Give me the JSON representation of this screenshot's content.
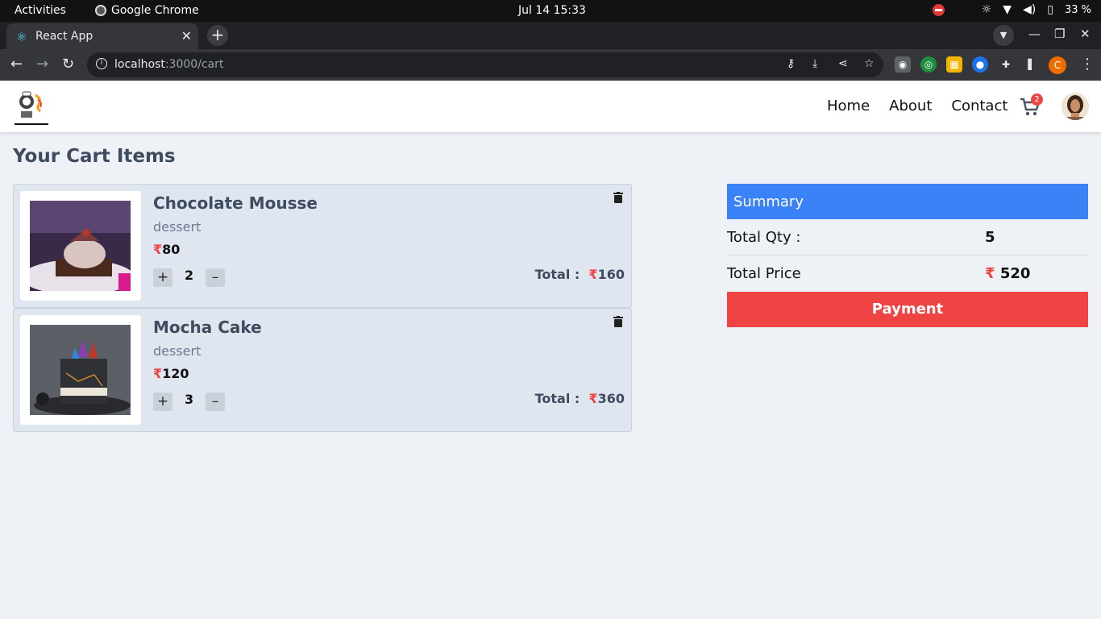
{
  "os_bar": {
    "activities": "Activities",
    "app_name": "Google Chrome",
    "clock": "Jul 14  15:33",
    "battery": "33 %"
  },
  "browser": {
    "tab_title": "React App",
    "url_host": "localhost",
    "url_path": ":3000/cart",
    "profile_initial": "C"
  },
  "navbar": {
    "links": [
      "Home",
      "About",
      "Contact"
    ],
    "cart_count": "2"
  },
  "cart": {
    "title": "Your Cart Items",
    "currency": "₹",
    "total_label": "Total :",
    "items": [
      {
        "name": "Chocolate Mousse",
        "category": "dessert",
        "price": "80",
        "qty": "2",
        "total": "160",
        "image": "chocolate-mousse-image"
      },
      {
        "name": "Mocha Cake",
        "category": "dessert",
        "price": "120",
        "qty": "3",
        "total": "360",
        "image": "mocha-cake-image"
      }
    ]
  },
  "summary": {
    "header": "Summary",
    "qty_label": "Total Qty :",
    "qty_value": "5",
    "price_label": "Total Price",
    "price_value": "₹ 520",
    "payment_label": "Payment"
  },
  "colors": {
    "summary_header": "#3b82f6",
    "payment_button": "#ef4444",
    "rupee": "#ef4444",
    "page_bg": "#eef2f7"
  }
}
